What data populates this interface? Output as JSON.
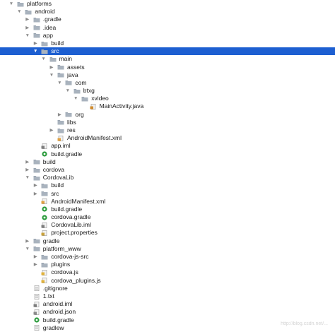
{
  "tree": {
    "rows": [
      {
        "label": "platforms",
        "depth": 0,
        "arrow": "down",
        "icon": "folder-icon"
      },
      {
        "label": "android",
        "depth": 1,
        "arrow": "down",
        "icon": "folder-icon"
      },
      {
        "label": ".gradle",
        "depth": 2,
        "arrow": "right",
        "icon": "folder-icon"
      },
      {
        "label": ".idea",
        "depth": 2,
        "arrow": "right",
        "icon": "folder-icon"
      },
      {
        "label": "app",
        "depth": 2,
        "arrow": "down",
        "icon": "folder-icon"
      },
      {
        "label": "build",
        "depth": 3,
        "arrow": "right",
        "icon": "folder-icon"
      },
      {
        "label": "src",
        "depth": 3,
        "arrow": "down",
        "icon": "folder-icon",
        "selected": true
      },
      {
        "label": "main",
        "depth": 4,
        "arrow": "down",
        "icon": "folder-icon"
      },
      {
        "label": "assets",
        "depth": 5,
        "arrow": "right",
        "icon": "folder-icon"
      },
      {
        "label": "java",
        "depth": 5,
        "arrow": "down",
        "icon": "folder-icon"
      },
      {
        "label": "com",
        "depth": 6,
        "arrow": "down",
        "icon": "folder-icon"
      },
      {
        "label": "btxg",
        "depth": 7,
        "arrow": "down",
        "icon": "folder-icon"
      },
      {
        "label": "xvideo",
        "depth": 8,
        "arrow": "down",
        "icon": "folder-icon"
      },
      {
        "label": "MainActivity.java",
        "depth": 9,
        "arrow": "none",
        "icon": "java-file-icon"
      },
      {
        "label": "org",
        "depth": 6,
        "arrow": "right",
        "icon": "folder-icon"
      },
      {
        "label": "libs",
        "depth": 5,
        "arrow": "none",
        "icon": "folder-icon"
      },
      {
        "label": "res",
        "depth": 5,
        "arrow": "right",
        "icon": "folder-icon"
      },
      {
        "label": "AndroidManifest.xml",
        "depth": 5,
        "arrow": "none",
        "icon": "xml-file-icon"
      },
      {
        "label": "app.iml",
        "depth": 3,
        "arrow": "none",
        "icon": "iml-file-icon"
      },
      {
        "label": "build.gradle",
        "depth": 3,
        "arrow": "none",
        "icon": "gradle-file-icon"
      },
      {
        "label": "build",
        "depth": 2,
        "arrow": "right",
        "icon": "folder-icon"
      },
      {
        "label": "cordova",
        "depth": 2,
        "arrow": "right",
        "icon": "folder-icon"
      },
      {
        "label": "CordovaLib",
        "depth": 2,
        "arrow": "down",
        "icon": "folder-icon"
      },
      {
        "label": "build",
        "depth": 3,
        "arrow": "right",
        "icon": "folder-icon"
      },
      {
        "label": "src",
        "depth": 3,
        "arrow": "right",
        "icon": "folder-icon"
      },
      {
        "label": "AndroidManifest.xml",
        "depth": 3,
        "arrow": "none",
        "icon": "xml-file-icon"
      },
      {
        "label": "build.gradle",
        "depth": 3,
        "arrow": "none",
        "icon": "gradle-file-icon"
      },
      {
        "label": "cordova.gradle",
        "depth": 3,
        "arrow": "none",
        "icon": "gradle-file-icon"
      },
      {
        "label": "CordovaLib.iml",
        "depth": 3,
        "arrow": "none",
        "icon": "iml-file-icon"
      },
      {
        "label": "project.properties",
        "depth": 3,
        "arrow": "none",
        "icon": "properties-file-icon"
      },
      {
        "label": "gradle",
        "depth": 2,
        "arrow": "right",
        "icon": "folder-icon"
      },
      {
        "label": "platform_www",
        "depth": 2,
        "arrow": "down",
        "icon": "folder-icon"
      },
      {
        "label": "cordova-js-src",
        "depth": 3,
        "arrow": "right",
        "icon": "folder-icon"
      },
      {
        "label": "plugins",
        "depth": 3,
        "arrow": "right",
        "icon": "folder-icon"
      },
      {
        "label": "cordova.js",
        "depth": 3,
        "arrow": "none",
        "icon": "js-file-icon"
      },
      {
        "label": "cordova_plugins.js",
        "depth": 3,
        "arrow": "none",
        "icon": "js-file-icon"
      },
      {
        "label": ".gitignore",
        "depth": 2,
        "arrow": "none",
        "icon": "text-file-icon"
      },
      {
        "label": "1.txt",
        "depth": 2,
        "arrow": "none",
        "icon": "text-file-icon"
      },
      {
        "label": "android.iml",
        "depth": 2,
        "arrow": "none",
        "icon": "iml-file-icon"
      },
      {
        "label": "android.json",
        "depth": 2,
        "arrow": "none",
        "icon": "json-file-icon"
      },
      {
        "label": "build.gradle",
        "depth": 2,
        "arrow": "none",
        "icon": "gradle-file-icon"
      },
      {
        "label": "gradlew",
        "depth": 2,
        "arrow": "none",
        "icon": "text-file-icon"
      }
    ]
  },
  "colors": {
    "selection": "#1d5fd1",
    "folder": "#9aa5b1",
    "gradle": "#2e9d3f",
    "java": "#d08a2a"
  },
  "watermark": "http://blog.csdn.net/..."
}
